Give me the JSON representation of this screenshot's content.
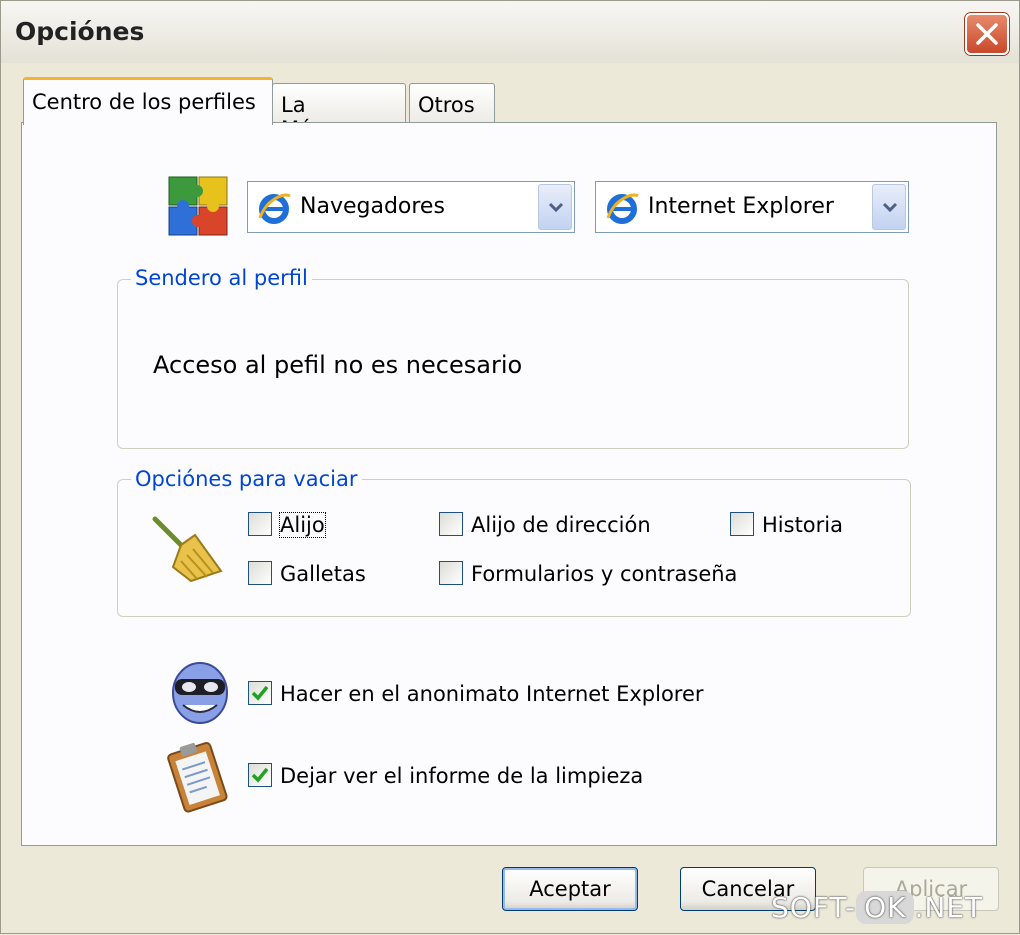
{
  "window": {
    "title": "Opciónes"
  },
  "tabs": [
    {
      "label": "Centro de los perfiles",
      "active": true
    },
    {
      "label": "La Máscara",
      "active": false
    },
    {
      "label": "Otros",
      "active": false
    }
  ],
  "profile": {
    "category_select": {
      "value": "Navegadores",
      "icon": "ie-icon"
    },
    "browser_select": {
      "value": "Internet Explorer",
      "icon": "ie-icon"
    }
  },
  "path_group": {
    "legend": "Sendero al perfil",
    "text": "Acceso al pefil no es necesario"
  },
  "clean_group": {
    "legend": "Opciónes para vaciar",
    "options": [
      {
        "label": "Alijo",
        "checked": false
      },
      {
        "label": "Alijo de dirección",
        "checked": false
      },
      {
        "label": "Historia",
        "checked": false
      },
      {
        "label": "Galletas",
        "checked": false
      },
      {
        "label": "Formularios y contraseña",
        "checked": false
      }
    ]
  },
  "anonymous": {
    "label": "Hacer en el anonimato Internet Explorer",
    "checked": true
  },
  "report": {
    "label": "Dejar ver el informe de la limpieza",
    "checked": true
  },
  "buttons": {
    "ok": "Aceptar",
    "cancel": "Cancelar",
    "apply": "Aplicar"
  },
  "watermark": {
    "left": "SOFT-",
    "mid": "OK",
    "right": ".NET"
  },
  "colors": {
    "legend": "#0046D5",
    "tab_accent": "#F4B335",
    "check": "#21A121"
  }
}
